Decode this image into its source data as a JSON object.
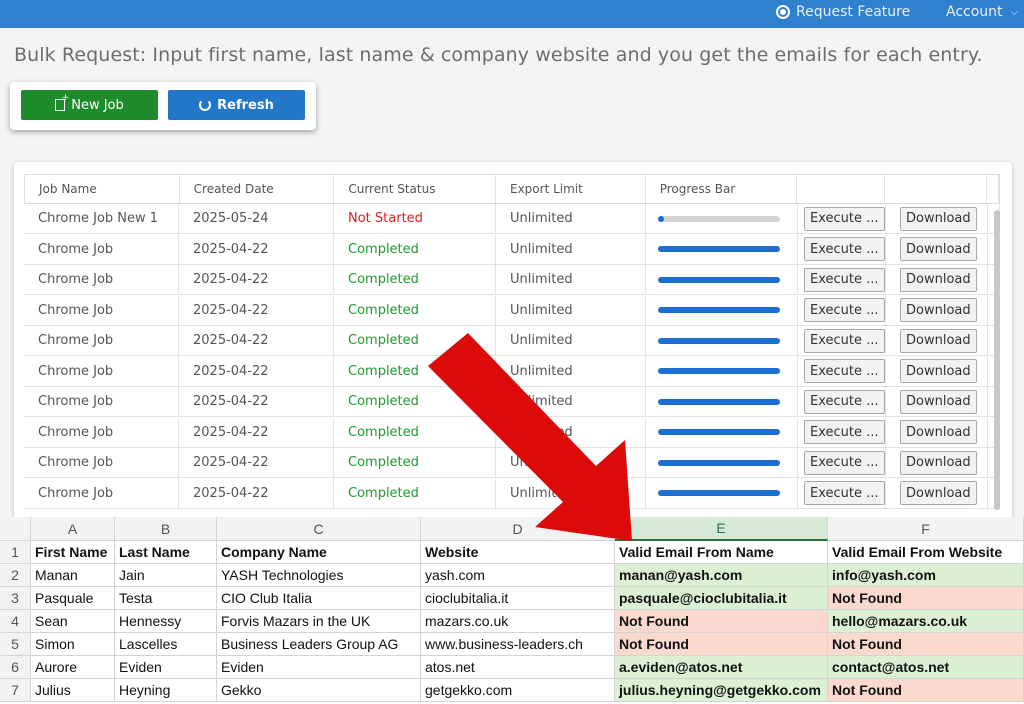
{
  "topbar": {
    "request_feature": "Request Feature",
    "account": "Account",
    "account_chevron": "⌄"
  },
  "headline": "Bulk Request: Input first name, last name & company website and you get the emails for each entry.",
  "toolbar": {
    "new_job_label": "New Job",
    "refresh_label": "Refresh",
    "new_job_color": "#1e8c2c",
    "refresh_color": "#2277c9"
  },
  "jobs": {
    "headers": [
      "Job Name",
      "Created Date",
      "Current Status",
      "Export Limit",
      "Progress Bar",
      "",
      ""
    ],
    "rows": [
      {
        "name": "Chrome Job New 1",
        "date": "2025-05-24",
        "status": "Not Started",
        "limit": "Unlimited",
        "progress": 0.04,
        "execute": "Execute ...",
        "download": "Download"
      },
      {
        "name": "Chrome Job",
        "date": "2025-04-22",
        "status": "Completed",
        "limit": "Unlimited",
        "progress": 1.0,
        "execute": "Execute ...",
        "download": "Download"
      },
      {
        "name": "Chrome Job",
        "date": "2025-04-22",
        "status": "Completed",
        "limit": "Unlimited",
        "progress": 1.0,
        "execute": "Execute ...",
        "download": "Download"
      },
      {
        "name": "Chrome Job",
        "date": "2025-04-22",
        "status": "Completed",
        "limit": "Unlimited",
        "progress": 1.0,
        "execute": "Execute ...",
        "download": "Download"
      },
      {
        "name": "Chrome Job",
        "date": "2025-04-22",
        "status": "Completed",
        "limit": "Unlimited",
        "progress": 1.0,
        "execute": "Execute ...",
        "download": "Download"
      },
      {
        "name": "Chrome Job",
        "date": "2025-04-22",
        "status": "Completed",
        "limit": "Unlimited",
        "progress": 1.0,
        "execute": "Execute ...",
        "download": "Download"
      },
      {
        "name": "Chrome Job",
        "date": "2025-04-22",
        "status": "Completed",
        "limit": "Unlimited",
        "progress": 1.0,
        "execute": "Execute ...",
        "download": "Download"
      },
      {
        "name": "Chrome Job",
        "date": "2025-04-22",
        "status": "Completed",
        "limit": "Unlimited",
        "progress": 1.0,
        "execute": "Execute ...",
        "download": "Download"
      },
      {
        "name": "Chrome Job",
        "date": "2025-04-22",
        "status": "Completed",
        "limit": "Unlimited",
        "progress": 1.0,
        "execute": "Execute ...",
        "download": "Download"
      },
      {
        "name": "Chrome Job",
        "date": "2025-04-22",
        "status": "Completed",
        "limit": "Unlimited",
        "progress": 1.0,
        "execute": "Execute ...",
        "download": "Download"
      }
    ],
    "status_colors": {
      "Not Started": "#e02020",
      "Completed": "#1f9b2f"
    },
    "progress_color": "#1b6fd0"
  },
  "sheet": {
    "column_letters": [
      "A",
      "B",
      "C",
      "D",
      "E",
      "F"
    ],
    "selected_column": "E",
    "header": [
      "First Name",
      "Last Name",
      "Company Name",
      "Website",
      "Valid Email From Name",
      "Valid Email From Website"
    ],
    "rows": [
      {
        "n": "2",
        "cells": [
          "Manan",
          "Jain",
          "YASH Technologies",
          "yash.com",
          "manan@yash.com",
          "info@yash.com"
        ],
        "e_found": true,
        "f_found": true
      },
      {
        "n": "3",
        "cells": [
          "Pasquale",
          "Testa",
          "CIO Club Italia",
          "cioclubitalia.it",
          "pasquale@cioclubitalia.it",
          "Not Found"
        ],
        "e_found": true,
        "f_found": false
      },
      {
        "n": "4",
        "cells": [
          "Sean",
          "Hennessy",
          "Forvis Mazars in the UK",
          "mazars.co.uk",
          "Not Found",
          "hello@mazars.co.uk"
        ],
        "e_found": false,
        "f_found": true
      },
      {
        "n": "5",
        "cells": [
          "Simon",
          "Lascelles",
          "Business Leaders Group AG",
          "www.business-leaders.ch",
          "Not Found",
          "Not Found"
        ],
        "e_found": false,
        "f_found": false
      },
      {
        "n": "6",
        "cells": [
          "Aurore",
          "Eviden",
          "Eviden",
          "atos.net",
          "a.eviden@atos.net",
          "contact@atos.net"
        ],
        "e_found": true,
        "f_found": true
      },
      {
        "n": "7",
        "cells": [
          "Julius",
          "Heyning",
          "Gekko",
          "getgekko.com",
          "julius.heyning@getgekko.com",
          "Not Found"
        ],
        "e_found": true,
        "f_found": false
      }
    ],
    "found_color": "#dcf0d4",
    "not_found_color": "#fbd9cf"
  },
  "annotation": {
    "arrow_color": "#dd0a0a"
  }
}
